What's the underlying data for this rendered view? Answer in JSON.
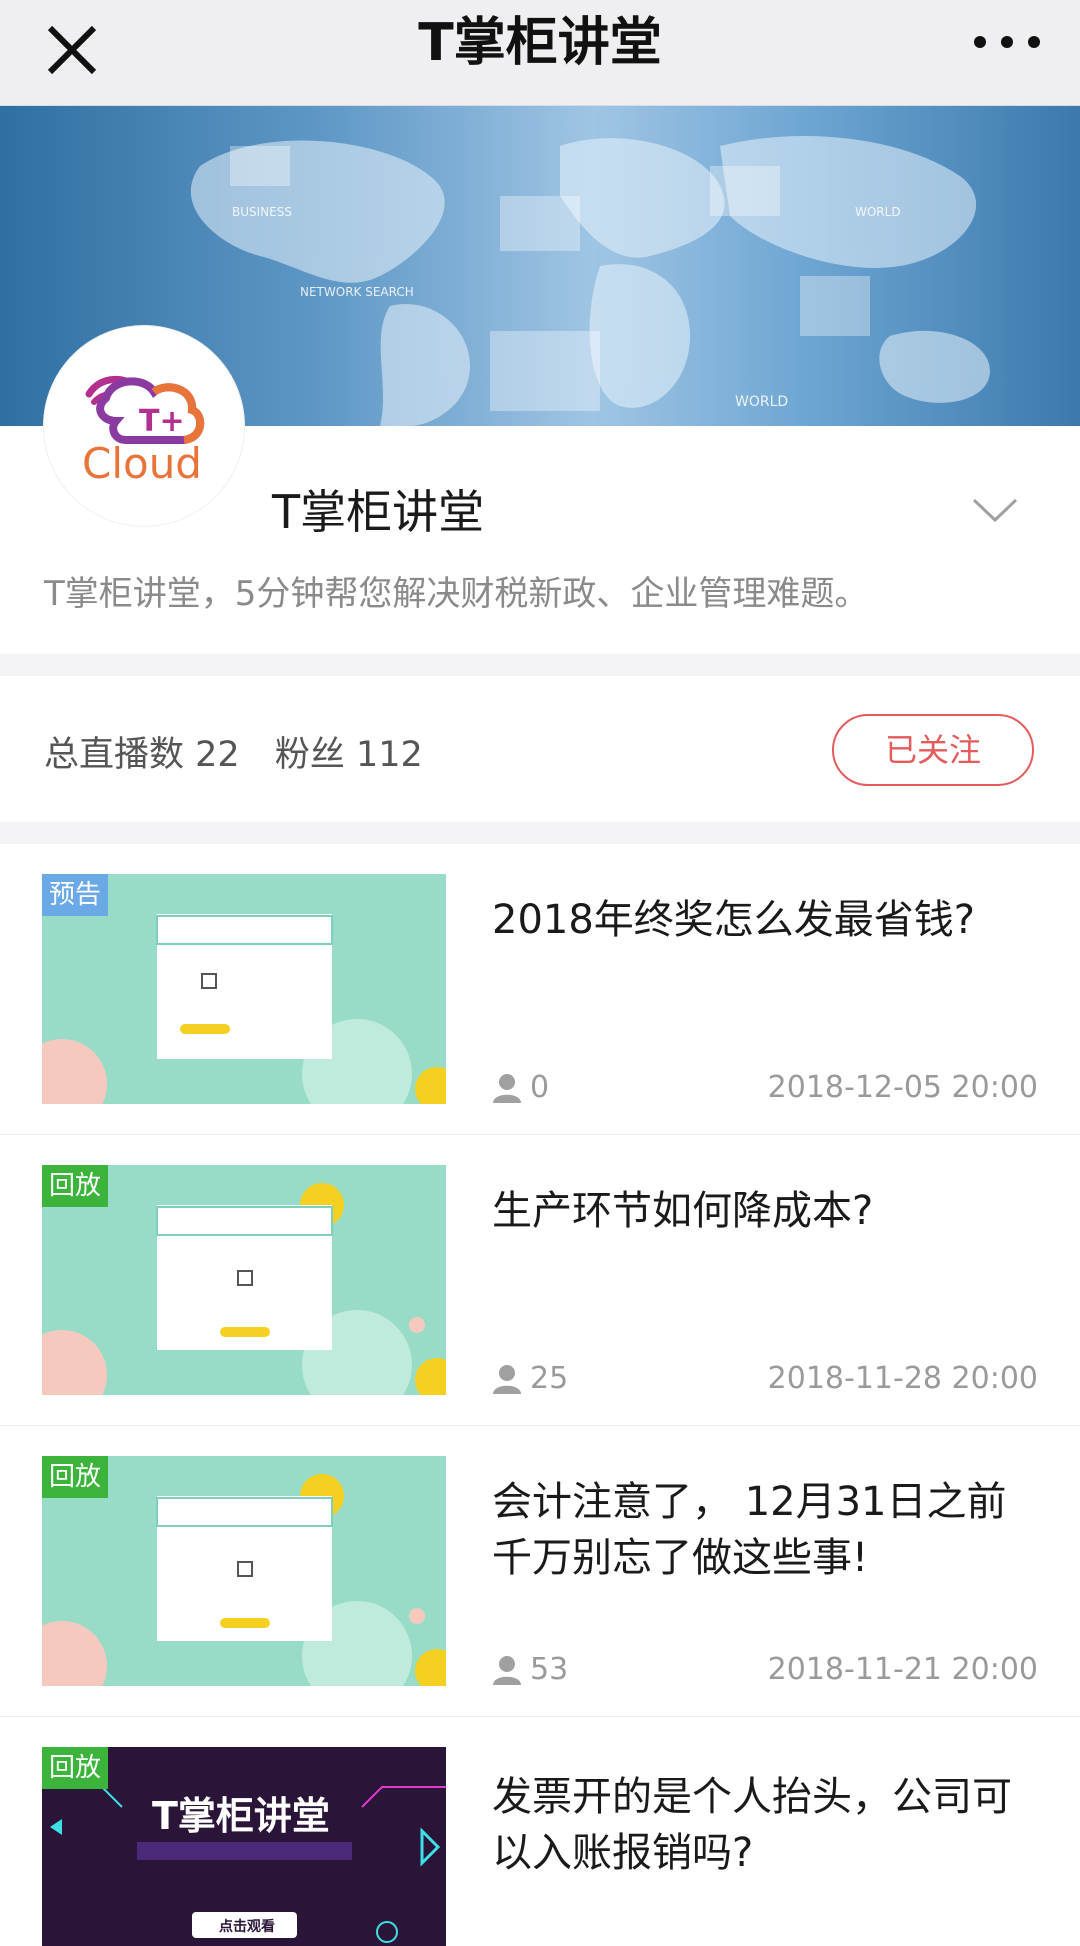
{
  "header": {
    "title": "T掌柜讲堂",
    "close_icon": "close-icon",
    "more_icon": "more-dots-icon"
  },
  "profile": {
    "name": "T掌柜讲堂",
    "description": "T掌柜讲堂，5分钟帮您解决财税新政、企业管理难题。",
    "logo_text": "Cloud",
    "logo_mark": "T+"
  },
  "banner": {
    "labels": [
      "BUSINESS",
      "NETWORK SEARCH",
      "WORLD",
      "WORLD"
    ]
  },
  "stats": {
    "broadcasts": "总直播数 22",
    "fans": "粉丝 112",
    "follow_label": "已关注"
  },
  "items": [
    {
      "badge": "预告",
      "badge_color": "#6aa8e6",
      "title": "2018年终奖怎么发最省钱?",
      "views": "0",
      "date": "2018-12-05 20:00"
    },
    {
      "badge": "回放",
      "badge_color": "#3cb43c",
      "title": "生产环节如何降成本?",
      "views": "25",
      "date": "2018-11-28 20:00"
    },
    {
      "badge": "回放",
      "badge_color": "#3cb43c",
      "title": "会计注意了， 12月31日之前千万别忘了做这些事!",
      "views": "53",
      "date": "2018-11-21 20:00"
    },
    {
      "badge": "回放",
      "badge_color": "#3cb43c",
      "title": "发票开的是个人抬头，公司可以入账报销吗?",
      "views": "",
      "date": ""
    }
  ],
  "thumb4": {
    "brand": "T掌柜讲堂",
    "button": "点击观看"
  },
  "colors": {
    "follow": "#e35b5b",
    "mint": "#98dcc8",
    "accent_yellow": "#f5d020"
  }
}
